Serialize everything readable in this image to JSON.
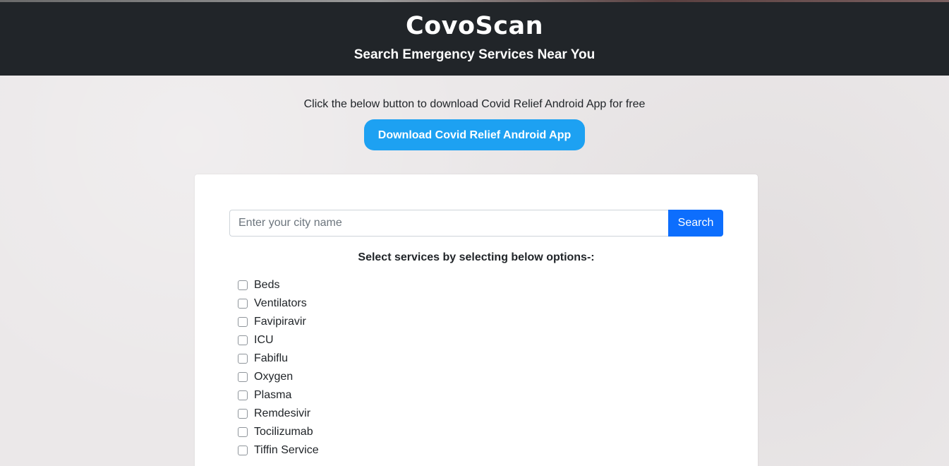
{
  "header": {
    "title": "CovoScan",
    "subtitle": "Search Emergency Services Near You"
  },
  "download": {
    "text": "Click the below button to download Covid Relief Android App for free",
    "button_label": "Download Covid Relief Android App"
  },
  "search": {
    "placeholder": "Enter your city name",
    "value": "",
    "button_label": "Search"
  },
  "services": {
    "heading": "Select services by selecting below options-:",
    "items": [
      {
        "label": "Beds",
        "checked": false
      },
      {
        "label": "Ventilators",
        "checked": false
      },
      {
        "label": "Favipiravir",
        "checked": false
      },
      {
        "label": "ICU",
        "checked": false
      },
      {
        "label": "Fabiflu",
        "checked": false
      },
      {
        "label": "Oxygen",
        "checked": false
      },
      {
        "label": "Plasma",
        "checked": false
      },
      {
        "label": "Remdesivir",
        "checked": false
      },
      {
        "label": "Tocilizumab",
        "checked": false
      },
      {
        "label": "Tiffin Service",
        "checked": false
      }
    ]
  },
  "colors": {
    "header_bg": "#212529",
    "download_button": "#1da1f2",
    "search_button": "#0d6efd"
  }
}
